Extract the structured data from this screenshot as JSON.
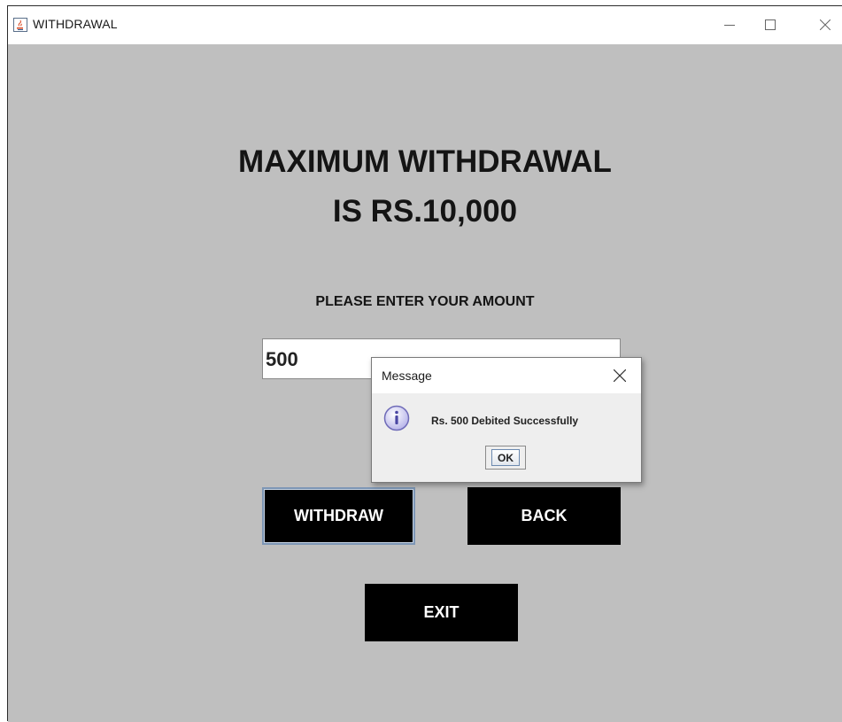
{
  "window": {
    "title": "WITHDRAWAL"
  },
  "main": {
    "heading_line1": "MAXIMUM WITHDRAWAL",
    "heading_line2": "IS RS.10,000",
    "prompt": "PLEASE ENTER YOUR AMOUNT",
    "amount_value": "500",
    "withdraw_label": "WITHDRAW",
    "back_label": "BACK",
    "exit_label": "EXIT"
  },
  "dialog": {
    "title": "Message",
    "message": "Rs. 500 Debited Successfully",
    "ok_label": "OK",
    "icon": "info-icon"
  },
  "colors": {
    "background": "#bfbfbf",
    "button": "#000000",
    "button_text": "#ffffff",
    "dialog_background": "#eeeeee"
  }
}
